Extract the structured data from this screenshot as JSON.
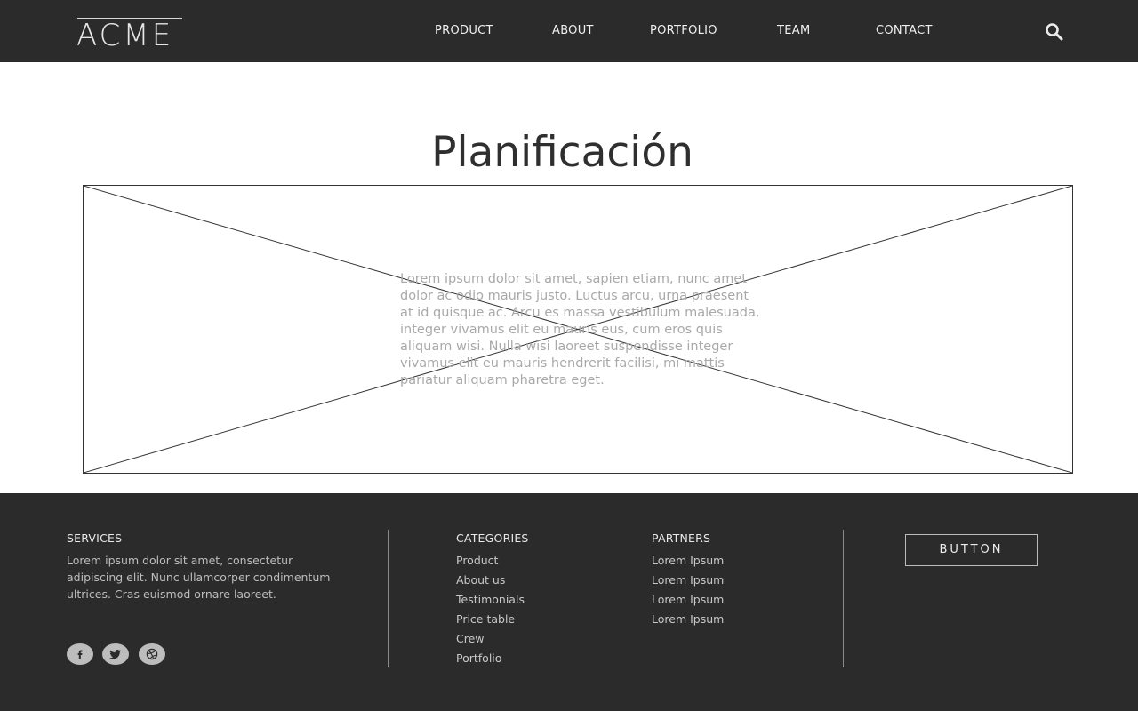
{
  "header": {
    "logo": "ACME",
    "nav": [
      "PRODUCT",
      "ABOUT",
      "PORTFOLIO",
      "TEAM",
      "CONTACT"
    ],
    "search_icon": "search-icon"
  },
  "main": {
    "title": "Planificación",
    "body": "Lorem ipsum dolor sit amet, sapien etiam, nunc amet dolor ac odio mauris justo. Luctus arcu, urna praesent at id quisque ac. Arcu es massa vestibulum malesuada, integer vivamus elit eu mauris eus, cum eros quis aliquam wisi. Nulla wisi laoreet suspendisse integer vivamus elit eu mauris hendrerit facilisi, mi mattis pariatur aliquam pharetra eget."
  },
  "footer": {
    "services": {
      "heading": "SERVICES",
      "text": "Lorem ipsum dolor sit amet, consectetur adipiscing elit. Nunc ullamcorper condimentum ultrices. Cras euismod ornare laoreet."
    },
    "categories": {
      "heading": "CATEGORIES",
      "links": [
        "Product",
        "About us",
        "Testimonials",
        "Price table",
        "Crew",
        "Portfolio"
      ]
    },
    "partners": {
      "heading": "PARTNERS",
      "links": [
        "Lorem Ipsum",
        "Lorem Ipsum",
        "Lorem Ipsum",
        "Lorem Ipsum"
      ]
    },
    "social": [
      "facebook-icon",
      "twitter-icon",
      "dribbble-icon"
    ],
    "button_label": "BUTTON"
  },
  "colors": {
    "header_bg": "#2b2b2b",
    "footer_bg": "#2b2b2b",
    "title_text": "#2f2f2f",
    "body_text": "#a9a9a9"
  }
}
